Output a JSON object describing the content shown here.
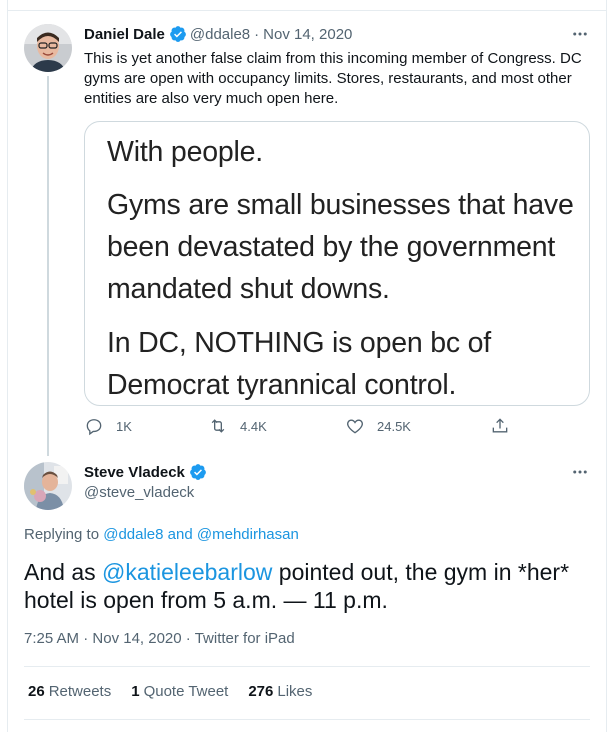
{
  "tweet1": {
    "name": "Daniel Dale",
    "handle": "@ddale8",
    "dot": "·",
    "date": "Nov 14, 2020",
    "text": "This is yet another false claim from this incoming member of Congress. DC gyms are open with occupancy limits. Stores, restaurants, and most other entities are also very much open here.",
    "image_text": [
      "With people.",
      "Gyms are small businesses that have",
      "been devastated by the government",
      "mandated shut downs.",
      "In DC, NOTHING is open bc of",
      "Democrat tyrannical control."
    ],
    "replies": "1K",
    "retweets": "4.4K",
    "likes": "24.5K"
  },
  "tweet2": {
    "name": "Steve Vladeck",
    "handle": "@steve_vladeck",
    "replying_prefix": "Replying to",
    "replying_user1": "@ddale8",
    "replying_and": "and",
    "replying_user2": "@mehdirhasan",
    "text_before": "And as ",
    "text_mention": "@katieleebarlow",
    "text_after": " pointed out, the gym in *her* hotel is open from 5 a.m. — 11 p.m.",
    "time": "7:25 AM",
    "date": "Nov 14, 2020",
    "source": "Twitter for iPad",
    "retweets_count": "26",
    "retweets_label": "Retweets",
    "quotes_count": "1",
    "quotes_label": "Quote Tweet",
    "likes_count": "276",
    "likes_label": "Likes"
  },
  "icons": {
    "verified": "verified-badge-icon",
    "more": "more-icon",
    "reply": "reply-icon",
    "retweet": "retweet-icon",
    "like": "heart-icon",
    "share": "share-icon"
  },
  "colors": {
    "accent": "#1b95e0",
    "verified": "#1d9bf0",
    "muted": "#536471"
  }
}
